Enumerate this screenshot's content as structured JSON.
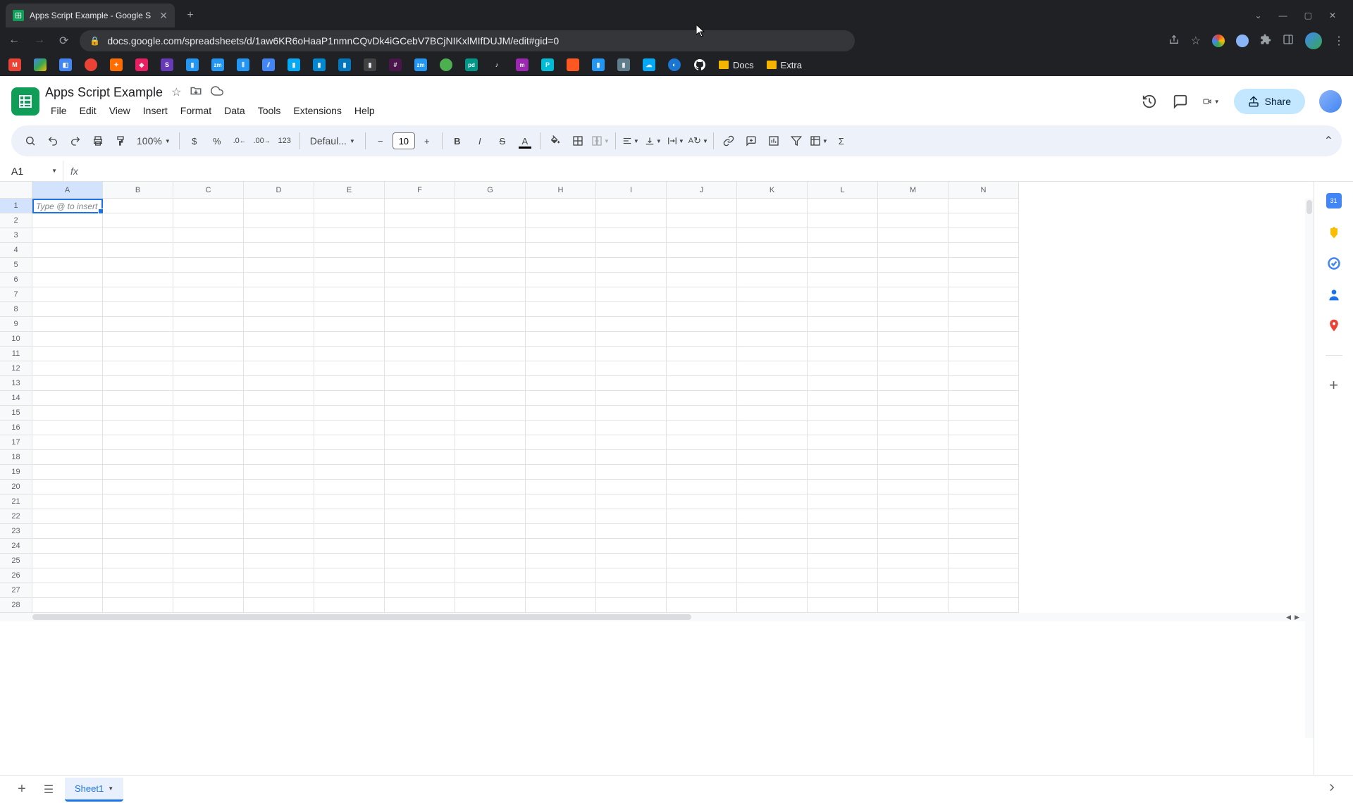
{
  "browser": {
    "tab_title": "Apps Script Example - Google S",
    "url": "docs.google.com/spreadsheets/d/1aw6KR6oHaaP1nmnCQvDk4iGCebV7BCjNIKxlMIfDUJM/edit#gid=0",
    "bookmarks": [
      {
        "label": "Docs"
      },
      {
        "label": "Extra"
      }
    ]
  },
  "doc": {
    "title": "Apps Script Example",
    "menus": [
      "File",
      "Edit",
      "View",
      "Insert",
      "Format",
      "Data",
      "Tools",
      "Extensions",
      "Help"
    ],
    "share_label": "Share"
  },
  "toolbar": {
    "zoom": "100%",
    "font": "Defaul...",
    "font_size": "10"
  },
  "formula": {
    "name_box": "A1"
  },
  "grid": {
    "columns": [
      "A",
      "B",
      "C",
      "D",
      "E",
      "F",
      "G",
      "H",
      "I",
      "J",
      "K",
      "L",
      "M",
      "N"
    ],
    "rows": 28,
    "active_cell": "A1",
    "placeholder": "Type @ to insert"
  },
  "sheets": {
    "active": "Sheet1"
  }
}
